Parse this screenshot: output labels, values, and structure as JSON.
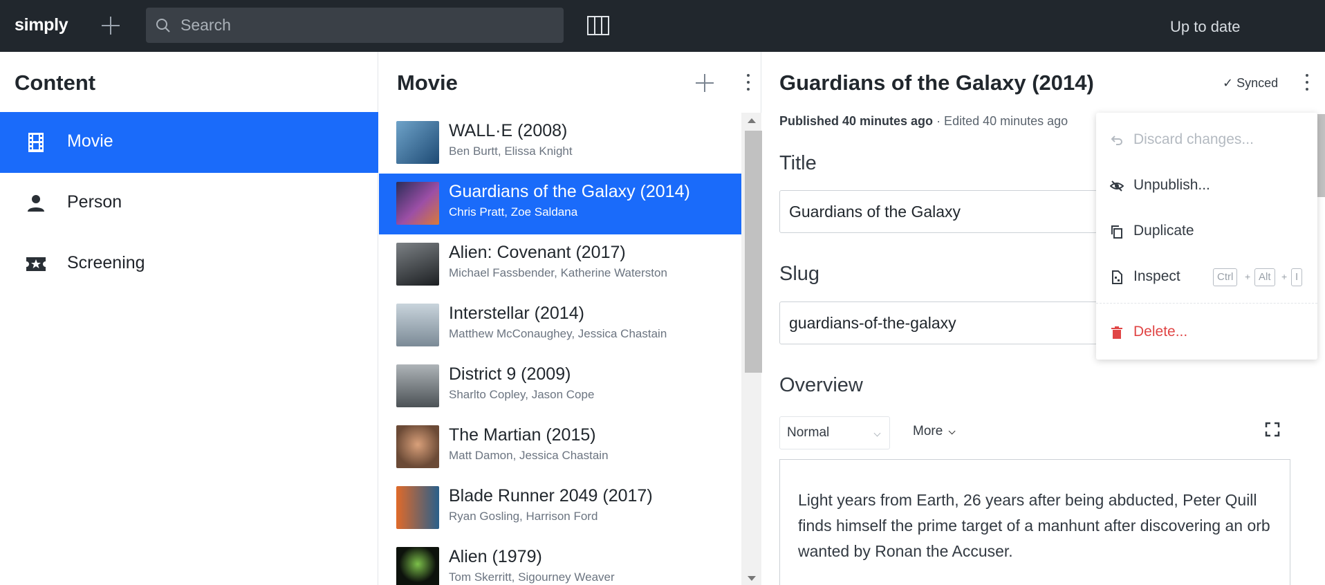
{
  "app": {
    "logo": "simply",
    "search_placeholder": "Search",
    "status": "Up to date"
  },
  "content_pane": {
    "title": "Content",
    "items": [
      {
        "label": "Movie",
        "icon": "film-icon",
        "active": true
      },
      {
        "label": "Person",
        "icon": "person-icon",
        "active": false
      },
      {
        "label": "Screening",
        "icon": "ticket-icon",
        "active": false
      }
    ]
  },
  "movie_pane": {
    "title": "Movie",
    "rows": [
      {
        "title": "WALL·E (2008)",
        "cast": "Ben Burtt, Elissa Knight",
        "poster_color": "#2f6d9e",
        "selected": false
      },
      {
        "title": "Guardians of the Galaxy (2014)",
        "cast": "Chris Pratt, Zoe Saldana",
        "poster_color": "#5b3c8c",
        "selected": true
      },
      {
        "title": "Alien: Covenant (2017)",
        "cast": "Michael Fassbender, Katherine Waterston",
        "poster_color": "#3a3f44",
        "selected": false
      },
      {
        "title": "Interstellar (2014)",
        "cast": "Matthew McConaughey, Jessica Chastain",
        "poster_color": "#9aa8b3",
        "selected": false
      },
      {
        "title": "District 9 (2009)",
        "cast": "Sharlto Copley, Jason Cope",
        "poster_color": "#6f7780",
        "selected": false
      },
      {
        "title": "The Martian (2015)",
        "cast": "Matt Damon, Jessica Chastain",
        "poster_color": "#b77a4a",
        "selected": false
      },
      {
        "title": "Blade Runner 2049 (2017)",
        "cast": "Ryan Gosling, Harrison Ford",
        "poster_color": "#d0542b",
        "selected": false
      },
      {
        "title": "Alien (1979)",
        "cast": "Tom Skerritt, Sigourney Weaver",
        "poster_color": "#1d2a1c",
        "selected": false
      }
    ]
  },
  "editor": {
    "title": "Guardians of the Galaxy (2014)",
    "synced": "Synced",
    "published_label": "Published 40 minutes ago",
    "edited_label": "· Edited 40 minutes ago",
    "fields": {
      "title_label": "Title",
      "title_value": "Guardians of the Galaxy",
      "slug_label": "Slug",
      "slug_value": "guardians-of-the-galaxy",
      "overview_label": "Overview",
      "format_select": "Normal",
      "more_label": "More",
      "overview_text": "Light years from Earth, 26 years after being abducted, Peter Quill finds himself the prime target of a manhunt after discovering an orb wanted by Ronan the Accuser."
    }
  },
  "menu": {
    "items": [
      {
        "label": "Discard changes...",
        "icon": "undo-icon",
        "disabled": true
      },
      {
        "label": "Unpublish...",
        "icon": "eye-off-icon"
      },
      {
        "label": "Duplicate",
        "icon": "copy-icon"
      },
      {
        "label": "Inspect",
        "icon": "inspect-icon"
      },
      {
        "label": "Delete...",
        "icon": "trash-icon",
        "danger": true
      }
    ],
    "shortcut": {
      "key1": "Ctrl",
      "key2": "Alt",
      "key3": "I",
      "sep": "+"
    }
  },
  "colors": {
    "topbar": "#21272d",
    "accent": "#1a6bfa",
    "danger": "#e04545"
  }
}
